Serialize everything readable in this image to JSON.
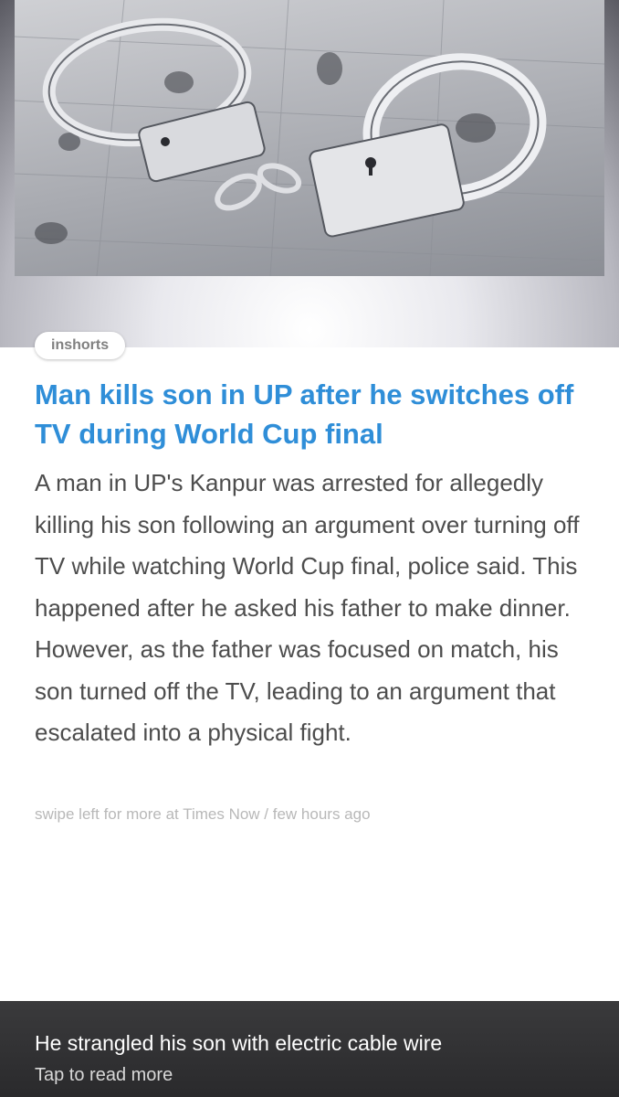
{
  "hero": {
    "image_subject": "handcuffs-on-fingerprint-card"
  },
  "source_tag": {
    "label": "inshorts"
  },
  "article": {
    "headline": "Man kills son in UP after he switches off TV during World Cup final",
    "body": "A man in UP's Kanpur was arrested for allegedly killing his son following an argument over turning off TV while watching World Cup final, police said. This happened after he asked his father to make dinner. However, as the father was focused on match, his son turned off the TV, leading to an argument that escalated into a physical fight.",
    "meta": "swipe left for more at Times Now / few hours ago"
  },
  "footer": {
    "title": "He strangled his son with electric cable wire",
    "cta": "Tap to read more"
  },
  "colors": {
    "headline": "#2f8ed8",
    "body_text": "#4d4d4d",
    "meta_text": "#b8b8b8",
    "footer_bg": "#2a2a2c"
  }
}
